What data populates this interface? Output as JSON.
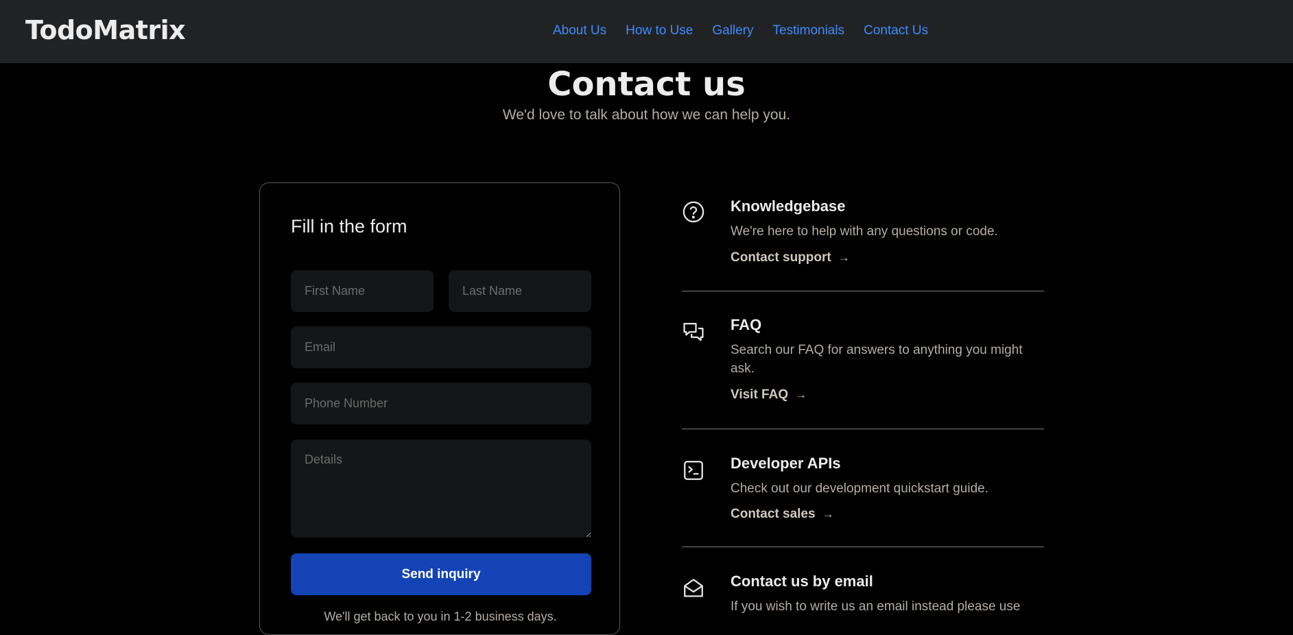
{
  "header": {
    "logo": "TodoMatrix",
    "nav": [
      "About Us",
      "How to Use",
      "Gallery",
      "Testimonials",
      "Contact Us"
    ]
  },
  "hero": {
    "title": "Contact us",
    "subtitle": "We'd love to talk about how we can help you."
  },
  "form": {
    "title": "Fill in the form",
    "first_name_placeholder": "First Name",
    "last_name_placeholder": "Last Name",
    "email_placeholder": "Email",
    "phone_placeholder": "Phone Number",
    "details_placeholder": "Details",
    "submit_label": "Send inquiry",
    "note": "We'll get back to you in 1-2 business days."
  },
  "info": [
    {
      "title": "Knowledgebase",
      "description": "We're here to help with any questions or code.",
      "link": "Contact support",
      "icon": "question-circle-icon"
    },
    {
      "title": "FAQ",
      "description": "Search our FAQ for answers to anything you might ask.",
      "link": "Visit FAQ",
      "icon": "chat-bubbles-icon"
    },
    {
      "title": "Developer APIs",
      "description": "Check out our development quickstart guide.",
      "link": "Contact sales",
      "icon": "terminal-icon"
    },
    {
      "title": "Contact us by email",
      "description": "If you wish to write us an email instead please use",
      "link": "",
      "icon": "envelope-open-icon"
    }
  ],
  "arrow_glyph": "→",
  "colors": {
    "background": "#000000",
    "navbar": "#212224",
    "link": "#3d8bfd",
    "button": "#1343b5"
  }
}
